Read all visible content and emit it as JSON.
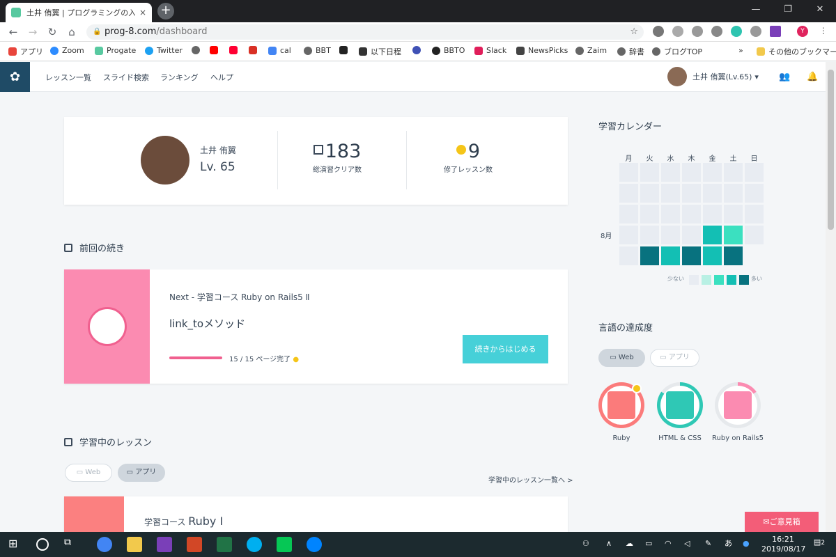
{
  "browser": {
    "tab_title": "土井 侑翼 | プログラミングの入門なら",
    "tab_close": "×",
    "new_tab": "+",
    "url_domain": "prog-8.com",
    "url_path": "/dashboard",
    "win_min": "—",
    "win_max": "❐",
    "win_close": "✕",
    "nav_back": "←",
    "nav_forward": "→",
    "nav_reload": "↻",
    "nav_home": "⌂",
    "star": "☆",
    "profile_letter": "Y",
    "bookmarks": [
      "アプリ",
      "Zoom",
      "Progate",
      "Twitter",
      "",
      "",
      "",
      "",
      "cal",
      "BBT",
      "",
      "以下日程",
      "",
      "BBTO",
      "Slack",
      "NewsPicks",
      "Zaim",
      "辞書",
      "ブログTOP"
    ],
    "bookmarks_more": "»",
    "other_bookmarks": "その他のブックマーク"
  },
  "header": {
    "menu": [
      "レッスン一覧",
      "スライド検索",
      "ランキング",
      "ヘルプ"
    ],
    "user_name": "土井 侑翼(Lv.65)",
    "user_caret": "▾"
  },
  "profile": {
    "name": "土井 侑翼",
    "level": "Lv. 65",
    "clears_value": "183",
    "clears_label": "総演習クリア数",
    "completed_value": "9",
    "completed_label": "修了レッスン数"
  },
  "continue": {
    "section_title": "前回の続き",
    "next_label": "Next - 学習コース Ruby on Rails5 Ⅱ",
    "lesson_title": "link_toメソッド",
    "progress_fraction": 1.0,
    "progress_text": "15 / 15 ページ完了",
    "button": "続きからはじめる"
  },
  "learning": {
    "section_title": "学習中のレッスン",
    "filters": [
      "Web",
      "アプリ"
    ],
    "list_link": "学習中のレッスン一覧へ >",
    "course_prefix": "学習コース",
    "course_name": "Ruby Ⅰ"
  },
  "calendar": {
    "title": "学習カレンダー",
    "weekdays": [
      "月",
      "火",
      "水",
      "木",
      "金",
      "土",
      "日"
    ],
    "month_label": "8月",
    "levels": [
      [
        0,
        0,
        0,
        0,
        0,
        0,
        0
      ],
      [
        0,
        0,
        0,
        0,
        0,
        0,
        0
      ],
      [
        0,
        0,
        0,
        0,
        0,
        0,
        0
      ],
      [
        0,
        0,
        0,
        0,
        3,
        2,
        0
      ],
      [
        0,
        4,
        3,
        4,
        3,
        4,
        -1
      ]
    ],
    "legend_less": "少ない",
    "legend_more": "多い",
    "colors": [
      "#e8ecf2",
      "#b8f0e4",
      "#3be0c0",
      "#13bfb4",
      "#08727f"
    ]
  },
  "languages": {
    "title": "言語の達成度",
    "filters": [
      "Web",
      "アプリ"
    ],
    "items": [
      {
        "label": "Ruby",
        "color": "#fb7b7b",
        "progress": 1.0
      },
      {
        "label": "HTML & CSS",
        "color": "#2fc8b5",
        "progress": 0.85
      },
      {
        "label": "Ruby on Rails5",
        "color": "#fb8bb1",
        "progress": 0.15
      }
    ]
  },
  "feedback": "✉ご意見箱",
  "taskbar": {
    "time": "16:21",
    "date": "2019/08/17",
    "ime": "あ",
    "notifications": "2"
  }
}
